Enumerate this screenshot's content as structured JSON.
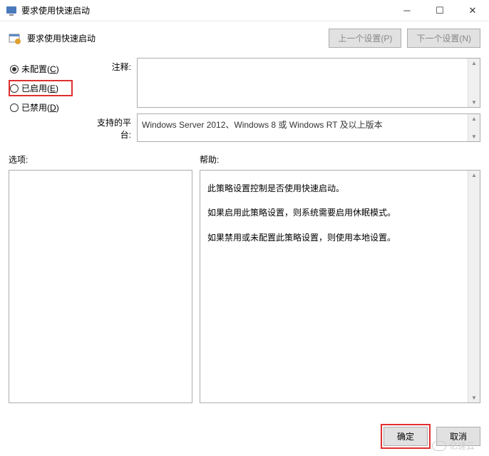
{
  "titlebar": {
    "title": "要求使用快速启动"
  },
  "header": {
    "policy_title": "要求使用快速启动",
    "prev_setting": "上一个设置(P)",
    "next_setting": "下一个设置(N)"
  },
  "radios": {
    "not_configured": {
      "label": "未配置",
      "accel": "C",
      "checked": true
    },
    "enabled": {
      "label": "已启用",
      "accel": "E",
      "checked": false
    },
    "disabled": {
      "label": "已禁用",
      "accel": "D",
      "checked": false
    }
  },
  "fields": {
    "comment_label": "注释:",
    "comment_value": "",
    "platform_label": "支持的平台:",
    "platform_value": "Windows Server 2012、Windows 8 或 Windows RT 及以上版本"
  },
  "options": {
    "label": "选项:"
  },
  "help": {
    "label": "帮助:",
    "lines": [
      "此策略设置控制是否使用快速启动。",
      "如果启用此策略设置，则系统需要启用休眠模式。",
      "如果禁用或未配置此策略设置，则使用本地设置。"
    ]
  },
  "footer": {
    "ok": "确定",
    "cancel": "取消"
  },
  "watermark": "亿速云"
}
